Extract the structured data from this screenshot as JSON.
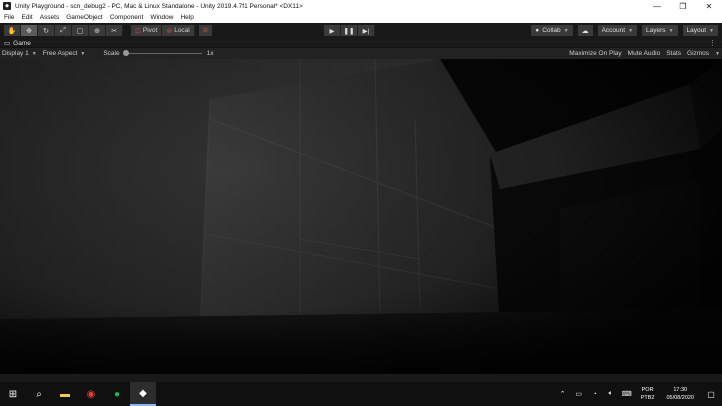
{
  "window": {
    "title": "Unity Playground - scn_debug2 - PC, Mac & Linux Standalone - Unity 2019.4.7f1 Personal* <DX11>",
    "controls": [
      "—",
      "❐",
      "✕"
    ]
  },
  "menu": [
    "File",
    "Edit",
    "Assets",
    "GameObject",
    "Component",
    "Window",
    "Help"
  ],
  "toolbar": {
    "pivot_label": "Pivot",
    "local_label": "Local",
    "collab_label": "Collab",
    "account_label": "Account",
    "layers_label": "Layers",
    "layout_label": "Layout"
  },
  "game_tab": {
    "label": "Game"
  },
  "game_toolbar": {
    "display": "Display 1",
    "aspect": "Free Aspect",
    "scale_label": "Scale",
    "scale_value": "1x",
    "maximize": "Maximize On Play",
    "mute": "Mute Audio",
    "stats": "Stats",
    "gizmos": "Gizmos"
  },
  "taskbar": {
    "language_top": "POR",
    "language_bottom": "PTB2",
    "time": "17:30",
    "date": "05/08/2020"
  },
  "colors": {
    "title_bg": "#ffffff",
    "toolbar_bg": "#191919",
    "taskbar_bg": "#101010"
  }
}
